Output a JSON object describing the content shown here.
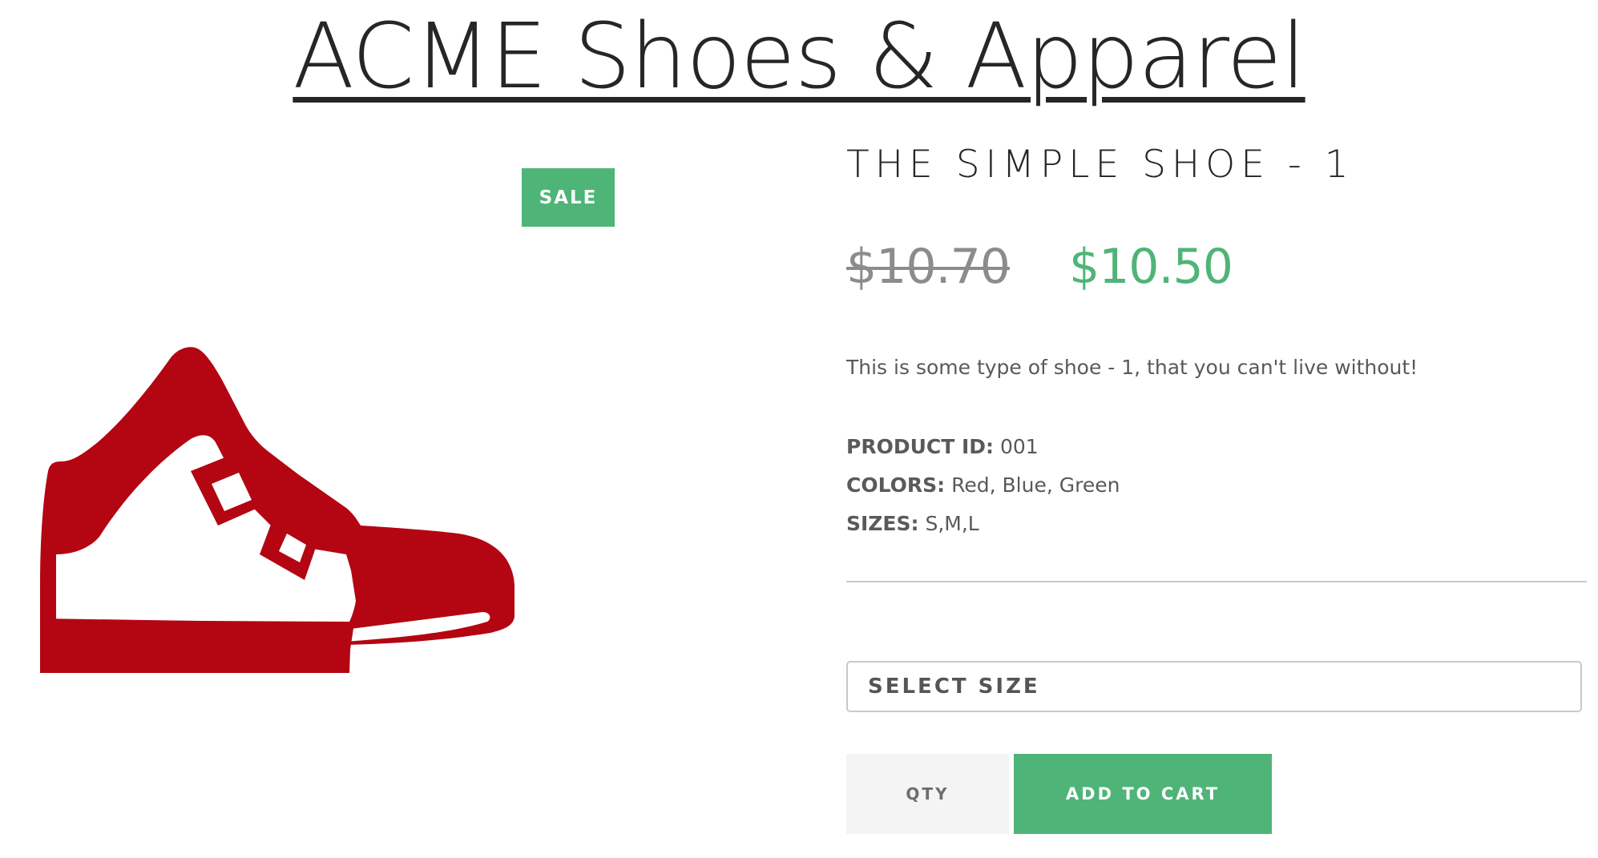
{
  "site": {
    "title": "ACME Shoes & Apparel"
  },
  "product": {
    "badge": "SALE",
    "image_icon": "sneaker-icon",
    "image_color": "#b30612",
    "name": "THE SIMPLE SHOE - 1",
    "old_price": "$10.70",
    "new_price": "$10.50",
    "description": "This is some type of shoe - 1, that you can't live without!",
    "specs": [
      {
        "label": "PRODUCT ID:",
        "value": "001"
      },
      {
        "label": "COLORS:",
        "value": "Red, Blue, Green"
      },
      {
        "label": "SIZES:",
        "value": "S,M,L"
      }
    ]
  },
  "purchase": {
    "size_select_label": "SELECT SIZE",
    "qty_placeholder": "QTY",
    "add_to_cart_label": "ADD TO CART"
  },
  "colors": {
    "accent": "#4fb477",
    "text": "#262626",
    "muted": "#8c8c8c"
  }
}
